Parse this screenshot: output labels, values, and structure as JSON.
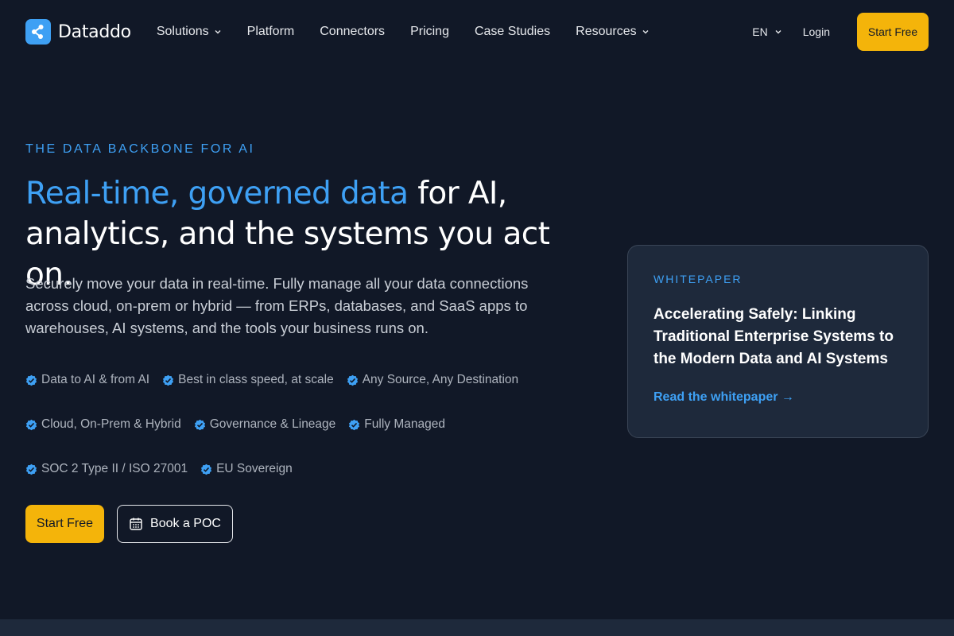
{
  "brand": {
    "name": "Dataddo"
  },
  "nav": {
    "items": [
      {
        "label": "Solutions",
        "dropdown": true
      },
      {
        "label": "Platform",
        "dropdown": false
      },
      {
        "label": "Connectors",
        "dropdown": false
      },
      {
        "label": "Pricing",
        "dropdown": false
      },
      {
        "label": "Case Studies",
        "dropdown": false
      },
      {
        "label": "Resources",
        "dropdown": true
      }
    ],
    "language": "EN",
    "login": "Login",
    "cta": "Start Free"
  },
  "hero": {
    "eyebrow": "THE DATA BACKBONE FOR AI",
    "title_accent": "Real-time, governed data",
    "title_rest": " for AI, analytics, and the systems you act on.",
    "description": "Securely move your data in real-time. Fully manage all your data connections across cloud, on-prem or hybrid — from ERPs, databases, and SaaS apps to warehouses, AI systems, and the tools your business runs on.",
    "features": [
      [
        "Data to AI & from AI",
        "Best in class speed, at scale",
        "Any Source, Any Destination"
      ],
      [
        "Cloud, On-Prem & Hybrid",
        "Governance & Lineage",
        "Fully Managed"
      ],
      [
        "SOC 2 Type II / ISO 27001",
        "EU Sovereign"
      ]
    ],
    "primary_cta": "Start Free",
    "secondary_cta": "Book a POC"
  },
  "whitepaper": {
    "eyebrow": "WHITEPAPER",
    "title": "Accelerating Safely: Linking Traditional Enterprise Systems to the Modern Data and AI Systems",
    "link": "Read the whitepaper →"
  },
  "colors": {
    "background": "#111827",
    "accent": "#3ea0f4",
    "cta": "#f4b40a",
    "card": "#1e293b"
  },
  "icons": {
    "logo": "dataddo-logo-icon",
    "dropdown": "chevron-down-icon",
    "feature": "verified-check-icon",
    "poc": "calendar-icon"
  }
}
